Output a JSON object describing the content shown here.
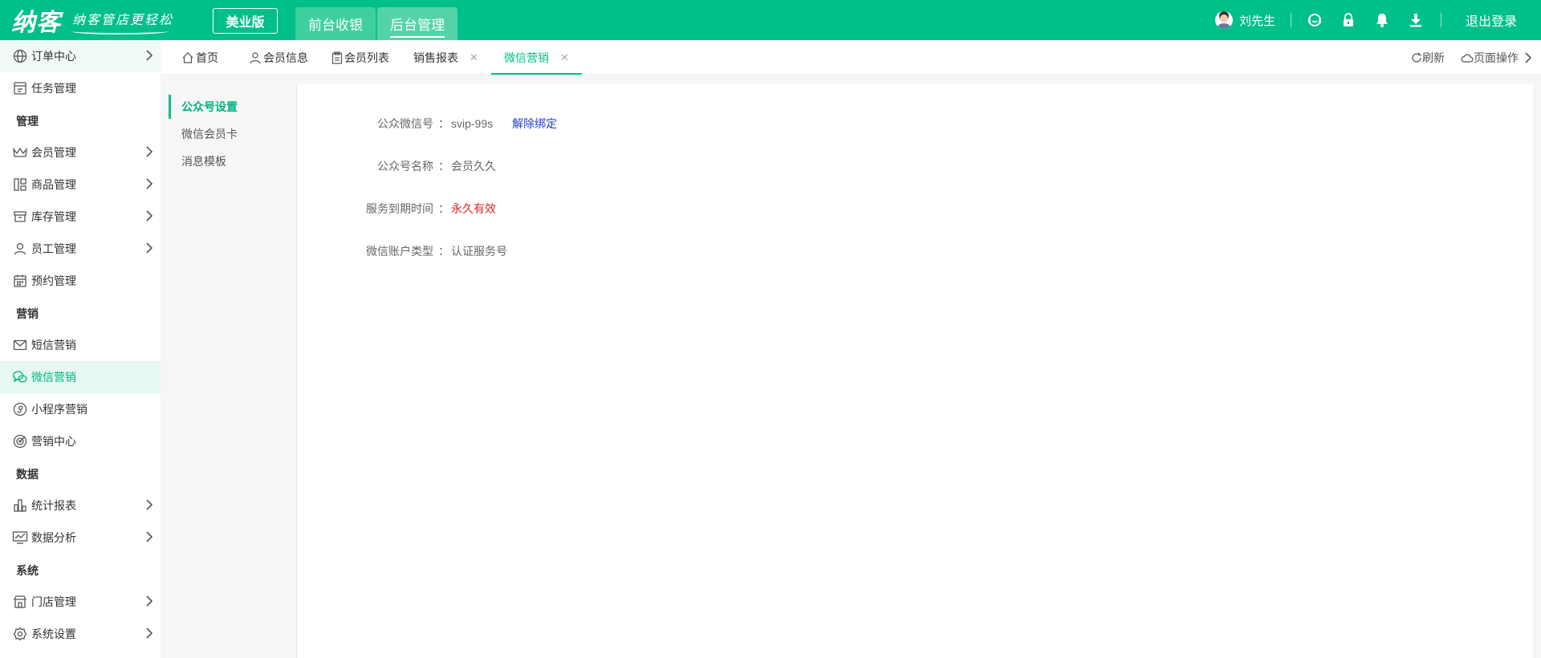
{
  "header": {
    "logo": "纳客",
    "slogan": "纳客管店更轻松",
    "edition": "美业版",
    "tabs": [
      "前台收银",
      "后台管理"
    ],
    "user_name": "刘先生",
    "logout": "退出登录",
    "icons": [
      "avatar",
      "support-icon",
      "lock-icon",
      "bell-icon",
      "download-icon"
    ]
  },
  "sidebar": {
    "items": [
      {
        "label": "订单中心",
        "icon": "globe-icon",
        "has_chevron": true
      },
      {
        "label": "任务管理",
        "icon": "task-icon",
        "has_chevron": false
      },
      {
        "group": "管理"
      },
      {
        "label": "会员管理",
        "icon": "crown-icon",
        "has_chevron": true
      },
      {
        "label": "商品管理",
        "icon": "grid-icon",
        "has_chevron": true
      },
      {
        "label": "库存管理",
        "icon": "box-icon",
        "has_chevron": true
      },
      {
        "label": "员工管理",
        "icon": "person-icon",
        "has_chevron": true
      },
      {
        "label": "预约管理",
        "icon": "calendar-icon",
        "has_chevron": false
      },
      {
        "group": "营销"
      },
      {
        "label": "短信营销",
        "icon": "mail-icon",
        "has_chevron": false
      },
      {
        "label": "微信营销",
        "icon": "wechat-icon",
        "has_chevron": false,
        "active": true
      },
      {
        "label": "小程序营销",
        "icon": "miniprogram-icon",
        "has_chevron": false
      },
      {
        "label": "营销中心",
        "icon": "target-icon",
        "has_chevron": false
      },
      {
        "group": "数据"
      },
      {
        "label": "统计报表",
        "icon": "bar-chart-icon",
        "has_chevron": true
      },
      {
        "label": "数据分析",
        "icon": "monitor-chart-icon",
        "has_chevron": true
      },
      {
        "group": "系统"
      },
      {
        "label": "门店管理",
        "icon": "store-icon",
        "has_chevron": true
      },
      {
        "label": "系统设置",
        "icon": "gear-icon",
        "has_chevron": true
      }
    ]
  },
  "tabs": {
    "items": [
      {
        "label": "首页",
        "icon": "home-icon",
        "closable": false
      },
      {
        "label": "会员信息",
        "icon": "user-icon",
        "closable": false
      },
      {
        "label": "会员列表",
        "icon": "clipboard-icon",
        "closable": false
      },
      {
        "label": "销售报表",
        "icon": "",
        "closable": true
      },
      {
        "label": "微信营销",
        "icon": "",
        "closable": true,
        "active": true
      }
    ],
    "refresh": "刷新",
    "page_ops": "页面操作"
  },
  "submenu": {
    "items": [
      "公众号设置",
      "微信会员卡",
      "消息模板"
    ],
    "active": "公众号设置"
  },
  "details": {
    "rows": [
      {
        "label": "公众微信号",
        "value": "svip-99s",
        "link": "解除绑定"
      },
      {
        "label": "公众号名称",
        "value": "会员久久"
      },
      {
        "label": "服务到期时间",
        "value": "永久有效",
        "highlight": true
      },
      {
        "label": "微信账户类型",
        "value": "认证服务号"
      }
    ],
    "colon": "："
  },
  "colors": {
    "brand": "#00c08a",
    "active_bg": "#e6f8f1",
    "warning": "#e02020",
    "link": "#1a3ee0"
  }
}
